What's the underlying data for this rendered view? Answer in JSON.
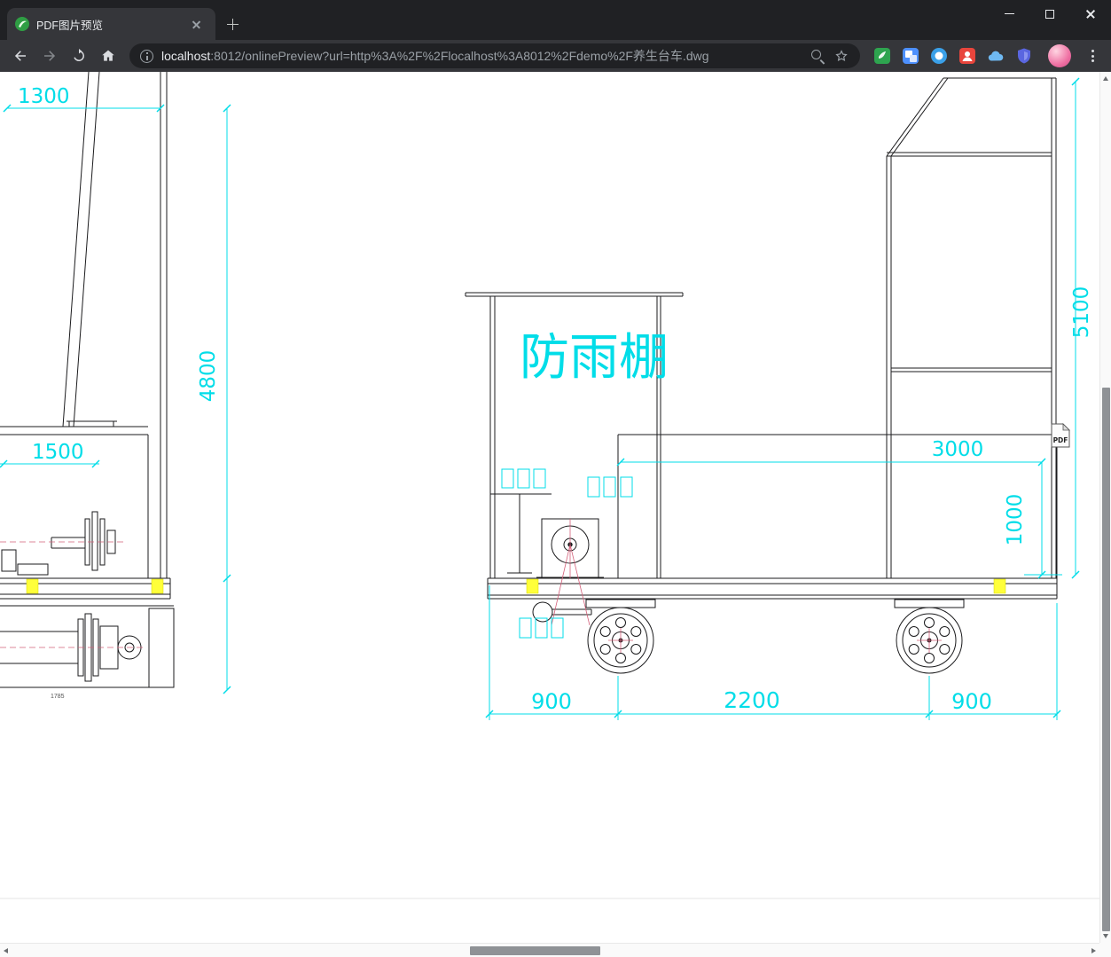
{
  "window": {
    "tab_title": "PDF图片预览"
  },
  "toolbar": {
    "url_host": "localhost",
    "url_rest": ":8012/onlinePreview?url=http%3A%2F%2Flocalhost%3A8012%2Fdemo%2F养生台车.dwg"
  },
  "drawing": {
    "shelter_label": "防雨棚",
    "dims": {
      "d1300": "1300",
      "d4800": "4800",
      "d1500": "1500",
      "d1785": "1785",
      "d5100": "5100",
      "d3000": "3000",
      "d1000": "1000",
      "d900_left": "900",
      "d2200": "2200",
      "d900_right": "900"
    },
    "pdf_badge": "PDF",
    "colors": {
      "dimension_cyan": "#00dde8",
      "line_black": "#1b1b1d",
      "highlight_yellow": "#ffff3a",
      "centerline_pink": "#d4607a"
    }
  }
}
